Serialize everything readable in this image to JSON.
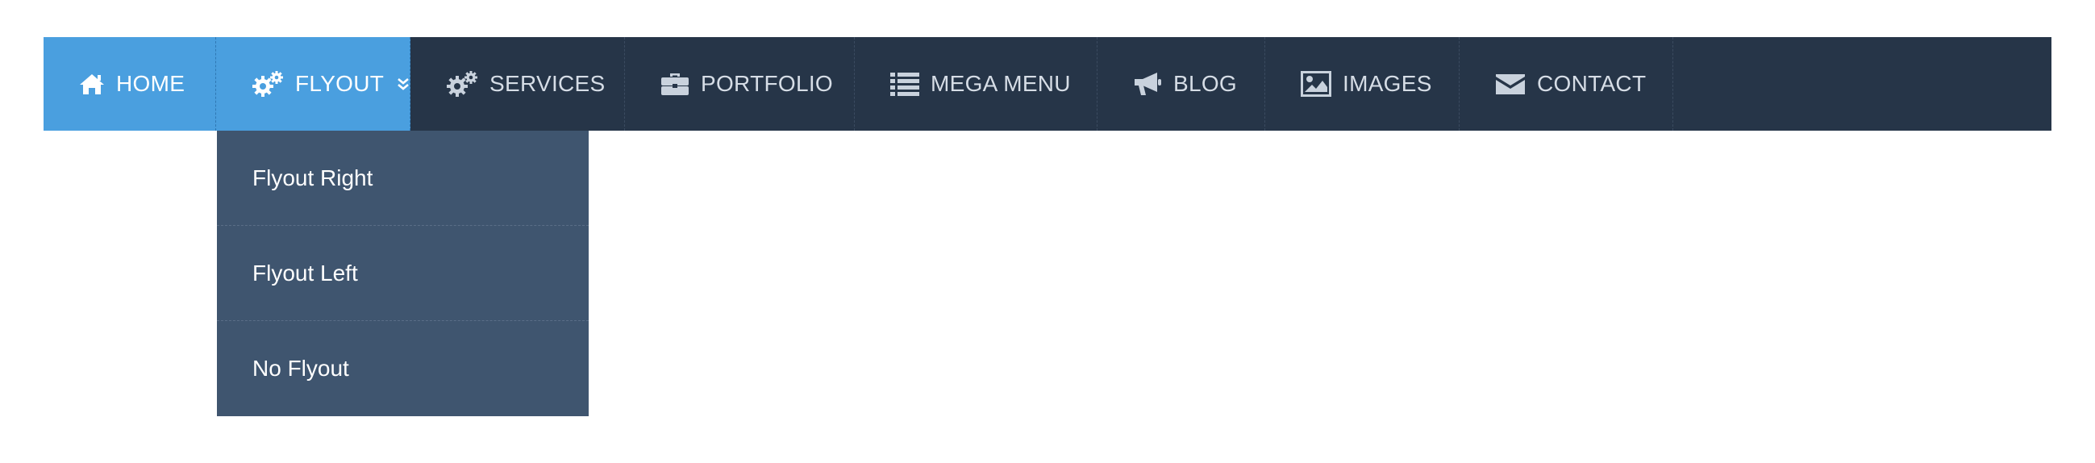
{
  "nav": {
    "items": [
      {
        "label": "HOME",
        "icon": "home-icon"
      },
      {
        "label": "FLYOUT",
        "icon": "cogs-icon"
      },
      {
        "label": "SERVICES",
        "icon": "cogs-icon"
      },
      {
        "label": "PORTFOLIO",
        "icon": "briefcase-icon"
      },
      {
        "label": "MEGA MENU",
        "icon": "list-icon"
      },
      {
        "label": "BLOG",
        "icon": "bullhorn-icon"
      },
      {
        "label": "IMAGES",
        "icon": "image-icon"
      },
      {
        "label": "CONTACT",
        "icon": "envelope-icon"
      }
    ],
    "active_item": "FLYOUT"
  },
  "dropdown": {
    "items": [
      {
        "label": "Flyout Right"
      },
      {
        "label": "Flyout Left"
      },
      {
        "label": "No Flyout"
      }
    ]
  },
  "colors": {
    "navbar_bg": "#263548",
    "active_bg": "#4a9fdf",
    "dropdown_bg": "#3f556f",
    "text": "#d6dde6"
  }
}
